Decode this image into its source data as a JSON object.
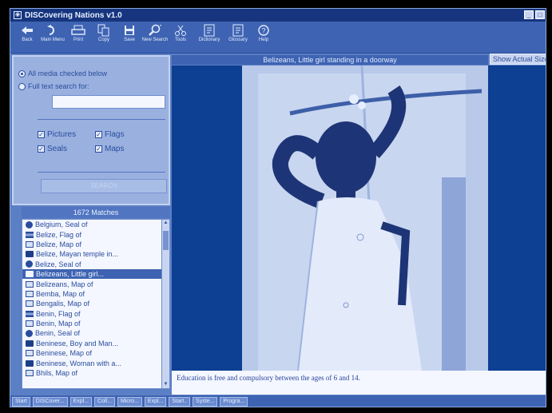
{
  "window": {
    "title": "DISCovering Nations v1.0",
    "controls": [
      "_",
      "□"
    ]
  },
  "toolbar": {
    "items": [
      {
        "label": "Back",
        "icon": "back-arrow-icon"
      },
      {
        "label": "Main Menu",
        "icon": "main-menu-icon"
      },
      {
        "label": "Print",
        "icon": "printer-icon"
      },
      {
        "label": "Copy",
        "icon": "copy-icon"
      },
      {
        "label": "Save",
        "icon": "save-disk-icon"
      },
      {
        "label": "New Search",
        "icon": "search-magnifier-icon"
      },
      {
        "label": "Tools",
        "icon": "scissors-icon"
      },
      {
        "label": "Dictionary",
        "icon": "dictionary-book-icon"
      },
      {
        "label": "Glossary",
        "icon": "glossary-book-icon"
      },
      {
        "label": "Help",
        "icon": "help-icon"
      }
    ]
  },
  "search_panel": {
    "radio_all_media": "All media checked below",
    "radio_full_text": "Full text search for:",
    "search_value": "",
    "checkboxes": [
      {
        "label": "Pictures",
        "checked": true
      },
      {
        "label": "Flags",
        "checked": true
      },
      {
        "label": "Seals",
        "checked": true
      },
      {
        "label": "Maps",
        "checked": true
      }
    ],
    "search_button_label": "SEARCH"
  },
  "results": {
    "header": "1672 Matches",
    "items": [
      {
        "label": "Belgium, Seal of",
        "type": "seal"
      },
      {
        "label": "Belize, Flag of",
        "type": "flag"
      },
      {
        "label": "Belize, Map of",
        "type": "map"
      },
      {
        "label": "Belize, Mayan temple in...",
        "type": "picture"
      },
      {
        "label": "Belize, Seal of",
        "type": "seal"
      },
      {
        "label": "Belizeans, Little girl...",
        "type": "picture",
        "selected": true
      },
      {
        "label": "Belizeans, Map of",
        "type": "map"
      },
      {
        "label": "Bemba, Map of",
        "type": "map"
      },
      {
        "label": "Bengalis, Map of",
        "type": "map"
      },
      {
        "label": "Benin, Flag of",
        "type": "flag"
      },
      {
        "label": "Benin, Map of",
        "type": "map"
      },
      {
        "label": "Benin, Seal of",
        "type": "seal"
      },
      {
        "label": "Beninese, Boy and Man...",
        "type": "picture"
      },
      {
        "label": "Beninese, Map of",
        "type": "map"
      },
      {
        "label": "Beninese, Woman with a...",
        "type": "picture"
      },
      {
        "label": "Bhils, Map of",
        "type": "map"
      }
    ]
  },
  "viewer": {
    "image_title": "Belizeans, Little girl standing in a doorway",
    "show_actual_label": "Show Actual Size",
    "caption": "Education is free and compulsory between the ages of 6 and 14."
  },
  "taskbar": {
    "items": [
      "Start",
      "DISCover...",
      "Expl...",
      "Coll...",
      "Micro...",
      "Expl...",
      "Start..",
      "Syste...",
      "Progra..."
    ]
  },
  "colors": {
    "background": "#5b7fc4",
    "title_bar": "#16357e",
    "image_background": "#0d3f93",
    "selection": "#3e63b2"
  }
}
